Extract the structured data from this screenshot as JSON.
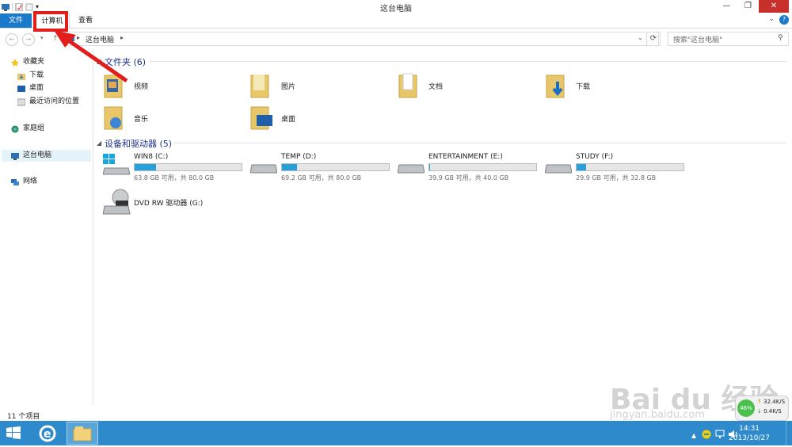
{
  "window": {
    "title": "这台电脑",
    "controls": {
      "minimize": "—",
      "maximize": "❐",
      "close": "✕"
    }
  },
  "ribbon": {
    "tabs": [
      {
        "label": "文件"
      },
      {
        "label": "计算机"
      },
      {
        "label": "查看"
      }
    ],
    "expand_glyph": "⌄",
    "help_glyph": "?"
  },
  "address": {
    "crumb": "这台电脑",
    "search_placeholder": "搜索\"这台电脑\""
  },
  "sidebar": {
    "favorites": {
      "label": "收藏夹",
      "items": [
        {
          "label": "下载"
        },
        {
          "label": "桌面"
        },
        {
          "label": "最近访问的位置"
        }
      ]
    },
    "homegroup": "家庭组",
    "this_pc": "这台电脑",
    "network": "网络"
  },
  "folders": {
    "header": "文件夹 (6)",
    "items": [
      {
        "label": "视频",
        "icon": "video-folder-icon"
      },
      {
        "label": "图片",
        "icon": "pictures-folder-icon"
      },
      {
        "label": "文档",
        "icon": "documents-folder-icon"
      },
      {
        "label": "下载",
        "icon": "downloads-folder-icon"
      },
      {
        "label": "音乐",
        "icon": "music-folder-icon"
      },
      {
        "label": "桌面",
        "icon": "desktop-folder-icon"
      }
    ]
  },
  "drives": {
    "header": "设备和驱动器 (5)",
    "items": [
      {
        "name": "WIN8 (C:)",
        "free": "63.8 GB 可用，共 80.0 GB",
        "used_fraction": 0.2
      },
      {
        "name": "TEMP (D:)",
        "free": "69.2 GB 可用，共 80.0 GB",
        "used_fraction": 0.14
      },
      {
        "name": "ENTERTAINMENT (E:)",
        "free": "39.9 GB 可用，共 40.0 GB",
        "used_fraction": 0.01
      },
      {
        "name": "STUDY (F:)",
        "free": "29.9 GB 可用，共 32.8 GB",
        "used_fraction": 0.09
      },
      {
        "name": "DVD RW 驱动器 (G:)"
      }
    ]
  },
  "status": {
    "count": "11 个项目"
  },
  "netmeter": {
    "percent": "46%",
    "up": "32.4K/S",
    "down": "0.4K/S"
  },
  "clock": {
    "time": "14:31",
    "date": "2013/10/27"
  },
  "watermark": {
    "brand": "Bai du 经验",
    "url": "jingyan.baidu.com"
  },
  "colors": {
    "accent": "#1979ca",
    "taskbar": "#2e8acb",
    "annotation": "#e31c1c",
    "drive_bar": "#26a0da"
  }
}
